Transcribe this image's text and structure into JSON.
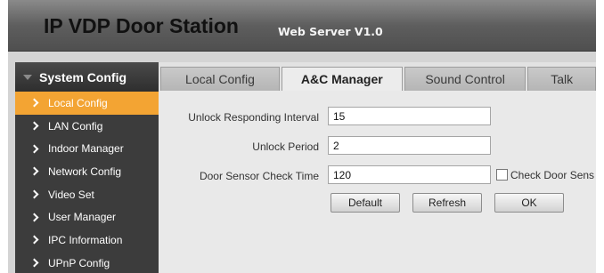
{
  "header": {
    "title": "IP VDP Door Station",
    "version": "Web Server V1.0"
  },
  "sidebar": {
    "heading": "System Config",
    "items": [
      {
        "label": "Local Config",
        "active": true
      },
      {
        "label": "LAN Config"
      },
      {
        "label": "Indoor Manager"
      },
      {
        "label": "Network Config"
      },
      {
        "label": "Video Set"
      },
      {
        "label": "User Manager"
      },
      {
        "label": "IPC Information"
      },
      {
        "label": "UPnP Config"
      }
    ]
  },
  "tabs": [
    {
      "label": "Local Config"
    },
    {
      "label": "A&C Manager",
      "active": true
    },
    {
      "label": "Sound Control"
    },
    {
      "label": "Talk"
    }
  ],
  "form": {
    "unlock_interval_label": "Unlock Responding Interval",
    "unlock_interval_value": "15",
    "unlock_period_label": "Unlock Period",
    "unlock_period_value": "2",
    "door_sensor_label": "Door Sensor Check Time",
    "door_sensor_value": "120",
    "check_door_label": "Check Door Sens"
  },
  "buttons": {
    "default": "Default",
    "refresh": "Refresh",
    "ok": "OK"
  }
}
